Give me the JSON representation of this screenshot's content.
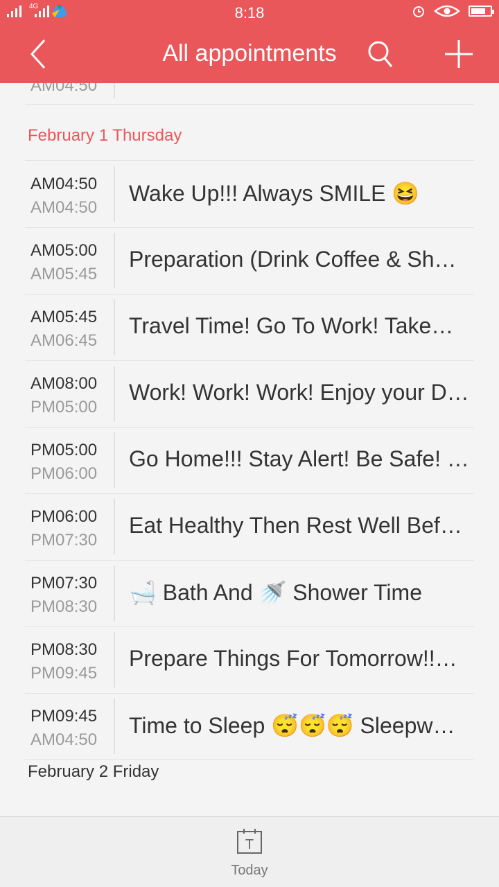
{
  "status_bar": {
    "time": "8:18",
    "network": "4G",
    "icons": [
      "signal-icon",
      "signal-icon",
      "google-drive-icon",
      "alarm-icon",
      "eye-icon",
      "battery-icon"
    ]
  },
  "header": {
    "title": "All appointments",
    "back_icon": "chevron-left-icon",
    "search_icon": "search-icon",
    "add_icon": "plus-icon"
  },
  "colors": {
    "accent": "#e9575a",
    "date_header_red": "#e9575a",
    "background": "#f4f4f4"
  },
  "partial_row": {
    "time_end": "AM04:50"
  },
  "sections": [
    {
      "date": "February 1 Thursday",
      "color": "#e9575a",
      "appointments": [
        {
          "start": "AM04:50",
          "end": "AM04:50",
          "title": "Wake Up!!! Always SMILE 😆"
        },
        {
          "start": "AM05:00",
          "end": "AM05:45",
          "title": "Preparation (Drink Coffee & Sh…"
        },
        {
          "start": "AM05:45",
          "end": "AM06:45",
          "title": "Travel Time! Go To Work! Take…"
        },
        {
          "start": "AM08:00",
          "end": "PM05:00",
          "title": "Work! Work! Work! Enjoy your D…"
        },
        {
          "start": "PM05:00",
          "end": "PM06:00",
          "title": "Go Home!!! Stay Alert! Be Safe! …"
        },
        {
          "start": "PM06:00",
          "end": "PM07:30",
          "title": "Eat Healthy Then Rest Well Bef…"
        },
        {
          "start": "PM07:30",
          "end": "PM08:30",
          "title": "🛁 Bath And 🚿 Shower Time"
        },
        {
          "start": "PM08:30",
          "end": "PM09:45",
          "title": "Prepare Things For Tomorrow!!…"
        },
        {
          "start": "PM09:45",
          "end": "AM04:50",
          "title": "Time to Sleep 😴😴😴 Sleepw…"
        }
      ]
    },
    {
      "date": "February 2 Friday",
      "color": "#333333",
      "appointments": []
    }
  ],
  "bottom_nav": {
    "today_icon_letter": "T",
    "today_label": "Today"
  }
}
